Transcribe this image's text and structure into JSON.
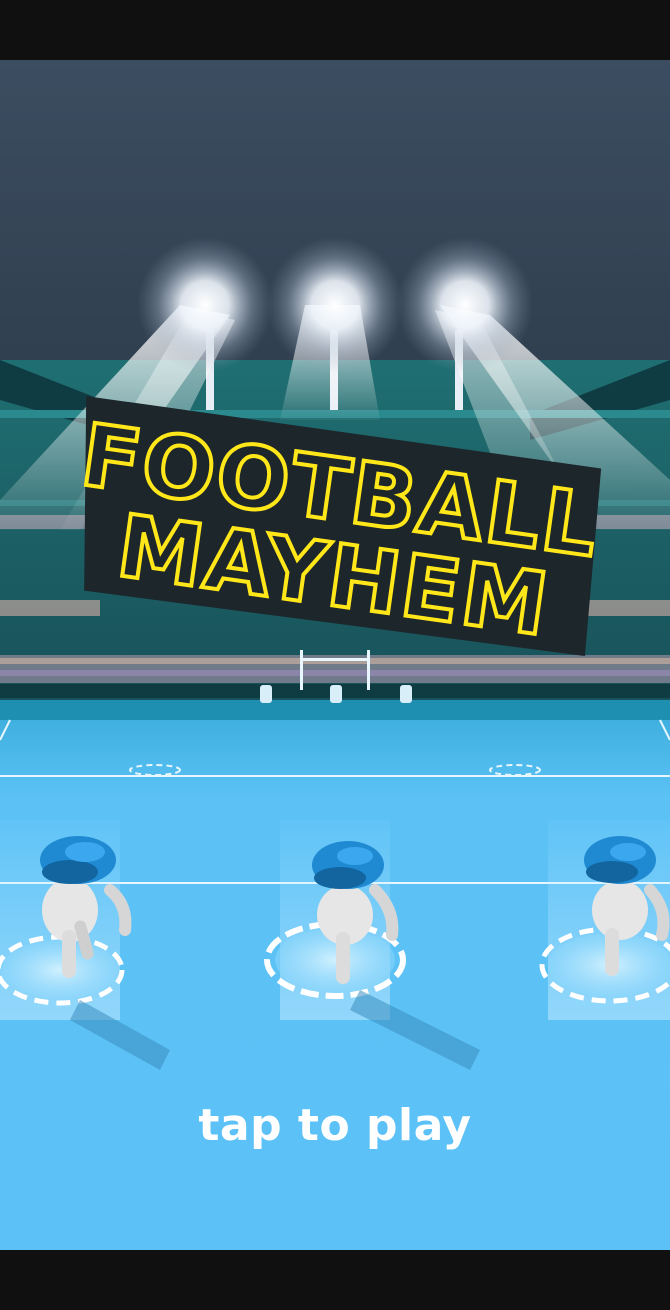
{
  "game": {
    "title_line1": "FOOTBALL",
    "title_line2": "MAYHEM",
    "prompt": "tap to play"
  },
  "colors": {
    "sky": "#3a4a5e",
    "stands": "#1b5a62",
    "field": "#5ac0f6",
    "title_outline": "#ffe71a",
    "title_backdrop": "#1c262b",
    "jersey": "#1e88d0"
  },
  "scene": {
    "floodlights": 3,
    "players": [
      {
        "name": "left-player"
      },
      {
        "name": "center-player"
      },
      {
        "name": "right-player"
      }
    ]
  }
}
